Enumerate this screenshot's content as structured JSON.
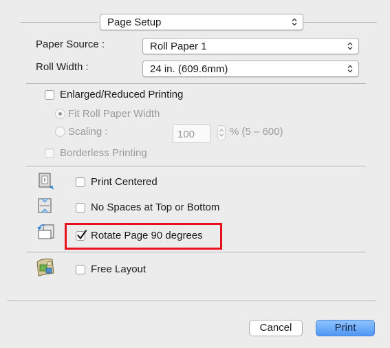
{
  "page_setup": {
    "selected": "Page Setup"
  },
  "paper_source": {
    "label": "Paper Source :",
    "value": "Roll Paper 1"
  },
  "roll_width": {
    "label": "Roll Width :",
    "value": "24 in. (609.6mm)"
  },
  "enlarged_reduced": {
    "label": "Enlarged/Reduced Printing",
    "checked": false,
    "fit_roll_label": "Fit Roll Paper Width",
    "scaling_label": "Scaling :",
    "scaling_value": "100",
    "scaling_range": "% (5 – 600)"
  },
  "borderless": {
    "label": "Borderless Printing",
    "checked": false
  },
  "print_centered": {
    "label": "Print Centered",
    "checked": false,
    "icon": "print-centered-icon"
  },
  "no_spaces": {
    "label": "No Spaces at Top or Bottom",
    "checked": false,
    "icon": "no-spaces-icon"
  },
  "rotate_page": {
    "label": "Rotate Page 90 degrees",
    "checked": true,
    "icon": "rotate-page-icon"
  },
  "free_layout": {
    "label": "Free Layout",
    "checked": false,
    "icon": "free-layout-icon"
  },
  "buttons": {
    "cancel": "Cancel",
    "print": "Print"
  },
  "colors": {
    "highlight": "#e8101b",
    "print_button": "#4f96f3"
  }
}
